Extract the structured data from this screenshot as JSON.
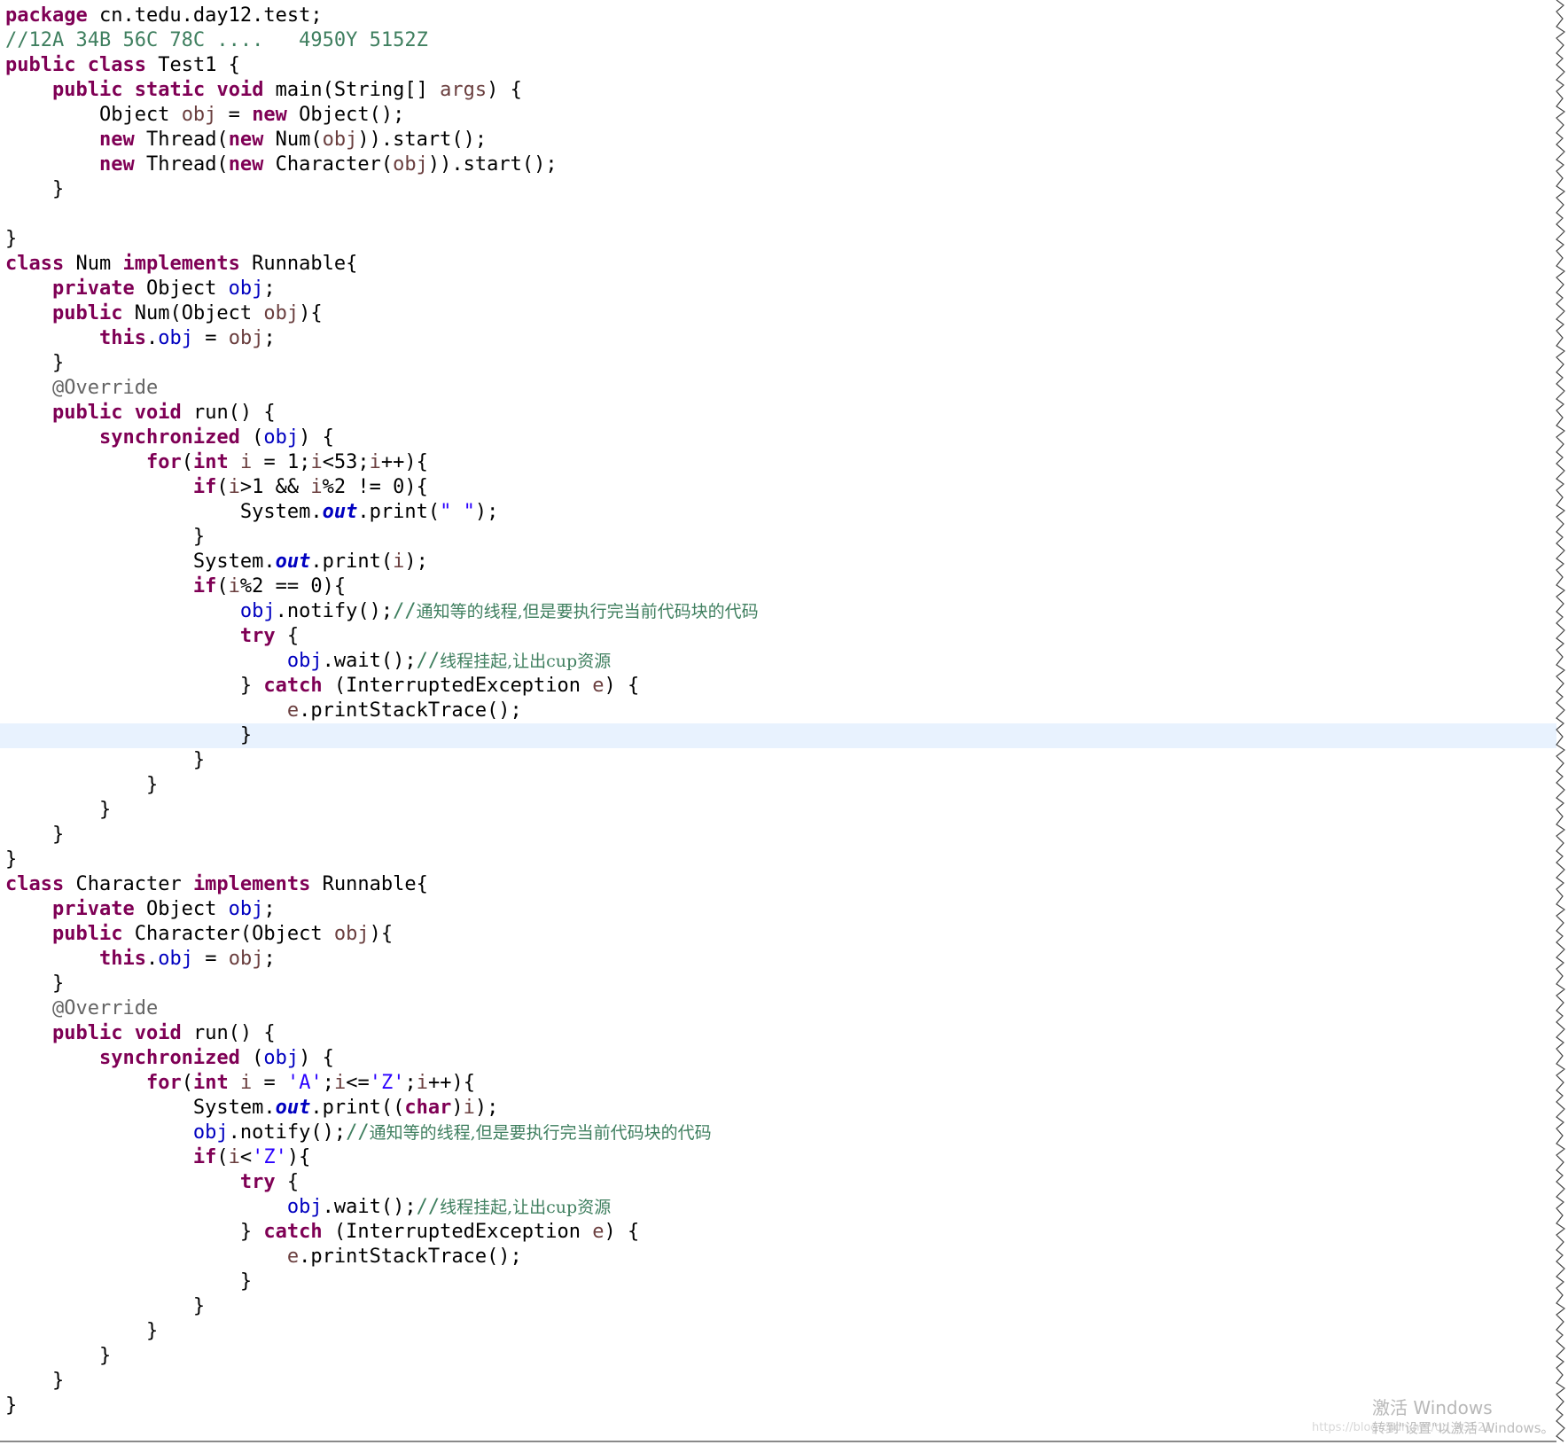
{
  "editor": {
    "language": "java",
    "current_line": 30,
    "colors": {
      "keyword": "#7f0055",
      "field": "#0000c0",
      "string": "#2a00ff",
      "comment": "#3f7f5f",
      "annotation": "#646464",
      "local_variable": "#6a3e3e",
      "current_line_highlight": "#e8f2fe"
    },
    "lines": [
      [
        {
          "t": "k",
          "v": "package"
        },
        {
          "t": "p",
          "v": " cn.tedu.day12.test;"
        }
      ],
      [
        {
          "t": "c",
          "v": "//12A 34B 56C 78C ....   4950Y 5152Z"
        }
      ],
      [
        {
          "t": "k",
          "v": "public"
        },
        {
          "t": "p",
          "v": " "
        },
        {
          "t": "k",
          "v": "class"
        },
        {
          "t": "p",
          "v": " Test1 {"
        }
      ],
      [
        {
          "t": "p",
          "v": "    "
        },
        {
          "t": "k",
          "v": "public"
        },
        {
          "t": "p",
          "v": " "
        },
        {
          "t": "k",
          "v": "static"
        },
        {
          "t": "p",
          "v": " "
        },
        {
          "t": "k",
          "v": "void"
        },
        {
          "t": "p",
          "v": " main(String[] "
        },
        {
          "t": "v",
          "v": "args"
        },
        {
          "t": "p",
          "v": ") {"
        }
      ],
      [
        {
          "t": "p",
          "v": "        Object "
        },
        {
          "t": "v",
          "v": "obj"
        },
        {
          "t": "p",
          "v": " = "
        },
        {
          "t": "k",
          "v": "new"
        },
        {
          "t": "p",
          "v": " Object();"
        }
      ],
      [
        {
          "t": "p",
          "v": "        "
        },
        {
          "t": "k",
          "v": "new"
        },
        {
          "t": "p",
          "v": " Thread("
        },
        {
          "t": "k",
          "v": "new"
        },
        {
          "t": "p",
          "v": " Num("
        },
        {
          "t": "v",
          "v": "obj"
        },
        {
          "t": "p",
          "v": ")).start();"
        }
      ],
      [
        {
          "t": "p",
          "v": "        "
        },
        {
          "t": "k",
          "v": "new"
        },
        {
          "t": "p",
          "v": " Thread("
        },
        {
          "t": "k",
          "v": "new"
        },
        {
          "t": "p",
          "v": " Character("
        },
        {
          "t": "v",
          "v": "obj"
        },
        {
          "t": "p",
          "v": ")).start();"
        }
      ],
      [
        {
          "t": "p",
          "v": "    }"
        }
      ],
      [
        {
          "t": "p",
          "v": ""
        }
      ],
      [
        {
          "t": "p",
          "v": "}"
        }
      ],
      [
        {
          "t": "k",
          "v": "class"
        },
        {
          "t": "p",
          "v": " Num "
        },
        {
          "t": "k",
          "v": "implements"
        },
        {
          "t": "p",
          "v": " Runnable{"
        }
      ],
      [
        {
          "t": "p",
          "v": "    "
        },
        {
          "t": "k",
          "v": "private"
        },
        {
          "t": "p",
          "v": " Object "
        },
        {
          "t": "f",
          "v": "obj"
        },
        {
          "t": "p",
          "v": ";"
        }
      ],
      [
        {
          "t": "p",
          "v": "    "
        },
        {
          "t": "k",
          "v": "public"
        },
        {
          "t": "p",
          "v": " Num(Object "
        },
        {
          "t": "v",
          "v": "obj"
        },
        {
          "t": "p",
          "v": "){"
        }
      ],
      [
        {
          "t": "p",
          "v": "        "
        },
        {
          "t": "k",
          "v": "this"
        },
        {
          "t": "p",
          "v": "."
        },
        {
          "t": "f",
          "v": "obj"
        },
        {
          "t": "p",
          "v": " = "
        },
        {
          "t": "v",
          "v": "obj"
        },
        {
          "t": "p",
          "v": ";"
        }
      ],
      [
        {
          "t": "p",
          "v": "    }"
        }
      ],
      [
        {
          "t": "p",
          "v": "    "
        },
        {
          "t": "a",
          "v": "@Override"
        }
      ],
      [
        {
          "t": "p",
          "v": "    "
        },
        {
          "t": "k",
          "v": "public"
        },
        {
          "t": "p",
          "v": " "
        },
        {
          "t": "k",
          "v": "void"
        },
        {
          "t": "p",
          "v": " run() {"
        }
      ],
      [
        {
          "t": "p",
          "v": "        "
        },
        {
          "t": "k",
          "v": "synchronized"
        },
        {
          "t": "p",
          "v": " ("
        },
        {
          "t": "f",
          "v": "obj"
        },
        {
          "t": "p",
          "v": ") {"
        }
      ],
      [
        {
          "t": "p",
          "v": "            "
        },
        {
          "t": "k",
          "v": "for"
        },
        {
          "t": "p",
          "v": "("
        },
        {
          "t": "k",
          "v": "int"
        },
        {
          "t": "p",
          "v": " "
        },
        {
          "t": "v",
          "v": "i"
        },
        {
          "t": "p",
          "v": " = 1;"
        },
        {
          "t": "v",
          "v": "i"
        },
        {
          "t": "p",
          "v": "<53;"
        },
        {
          "t": "v",
          "v": "i"
        },
        {
          "t": "p",
          "v": "++){"
        }
      ],
      [
        {
          "t": "p",
          "v": "                "
        },
        {
          "t": "k",
          "v": "if"
        },
        {
          "t": "p",
          "v": "("
        },
        {
          "t": "v",
          "v": "i"
        },
        {
          "t": "p",
          "v": ">1 && "
        },
        {
          "t": "v",
          "v": "i"
        },
        {
          "t": "p",
          "v": "%2 != 0){"
        }
      ],
      [
        {
          "t": "p",
          "v": "                    System."
        },
        {
          "t": "sf",
          "v": "out"
        },
        {
          "t": "p",
          "v": ".print("
        },
        {
          "t": "s",
          "v": "\" \""
        },
        {
          "t": "p",
          "v": ");"
        }
      ],
      [
        {
          "t": "p",
          "v": "                }"
        }
      ],
      [
        {
          "t": "p",
          "v": "                System."
        },
        {
          "t": "sf",
          "v": "out"
        },
        {
          "t": "p",
          "v": ".print("
        },
        {
          "t": "v",
          "v": "i"
        },
        {
          "t": "p",
          "v": ");"
        }
      ],
      [
        {
          "t": "p",
          "v": "                "
        },
        {
          "t": "k",
          "v": "if"
        },
        {
          "t": "p",
          "v": "("
        },
        {
          "t": "v",
          "v": "i"
        },
        {
          "t": "p",
          "v": "%2 == 0){"
        }
      ],
      [
        {
          "t": "p",
          "v": "                    "
        },
        {
          "t": "f",
          "v": "obj"
        },
        {
          "t": "p",
          "v": ".notify();"
        },
        {
          "t": "c",
          "v": "//"
        },
        {
          "t": "ca",
          "v": "通知等的线程,但是要执行完当前代码块的代码"
        }
      ],
      [
        {
          "t": "p",
          "v": "                    "
        },
        {
          "t": "k",
          "v": "try"
        },
        {
          "t": "p",
          "v": " {"
        }
      ],
      [
        {
          "t": "p",
          "v": "                        "
        },
        {
          "t": "f",
          "v": "obj"
        },
        {
          "t": "p",
          "v": ".wait();"
        },
        {
          "t": "c",
          "v": "//"
        },
        {
          "t": "ca",
          "v": "线程挂起,让出cup资源"
        }
      ],
      [
        {
          "t": "p",
          "v": "                    } "
        },
        {
          "t": "k",
          "v": "catch"
        },
        {
          "t": "p",
          "v": " (InterruptedException "
        },
        {
          "t": "v",
          "v": "e"
        },
        {
          "t": "p",
          "v": ") {"
        }
      ],
      [
        {
          "t": "p",
          "v": "                        "
        },
        {
          "t": "v",
          "v": "e"
        },
        {
          "t": "p",
          "v": ".printStackTrace();"
        }
      ],
      [
        {
          "t": "p",
          "v": "                    }"
        }
      ],
      [
        {
          "t": "p",
          "v": "                }"
        }
      ],
      [
        {
          "t": "p",
          "v": "            }"
        }
      ],
      [
        {
          "t": "p",
          "v": "        }"
        }
      ],
      [
        {
          "t": "p",
          "v": "    }"
        }
      ],
      [
        {
          "t": "p",
          "v": "}"
        }
      ],
      [
        {
          "t": "k",
          "v": "class"
        },
        {
          "t": "p",
          "v": " Character "
        },
        {
          "t": "k",
          "v": "implements"
        },
        {
          "t": "p",
          "v": " Runnable{"
        }
      ],
      [
        {
          "t": "p",
          "v": "    "
        },
        {
          "t": "k",
          "v": "private"
        },
        {
          "t": "p",
          "v": " Object "
        },
        {
          "t": "f",
          "v": "obj"
        },
        {
          "t": "p",
          "v": ";"
        }
      ],
      [
        {
          "t": "p",
          "v": "    "
        },
        {
          "t": "k",
          "v": "public"
        },
        {
          "t": "p",
          "v": " Character(Object "
        },
        {
          "t": "v",
          "v": "obj"
        },
        {
          "t": "p",
          "v": "){"
        }
      ],
      [
        {
          "t": "p",
          "v": "        "
        },
        {
          "t": "k",
          "v": "this"
        },
        {
          "t": "p",
          "v": "."
        },
        {
          "t": "f",
          "v": "obj"
        },
        {
          "t": "p",
          "v": " = "
        },
        {
          "t": "v",
          "v": "obj"
        },
        {
          "t": "p",
          "v": ";"
        }
      ],
      [
        {
          "t": "p",
          "v": "    }"
        }
      ],
      [
        {
          "t": "p",
          "v": "    "
        },
        {
          "t": "a",
          "v": "@Override"
        }
      ],
      [
        {
          "t": "p",
          "v": "    "
        },
        {
          "t": "k",
          "v": "public"
        },
        {
          "t": "p",
          "v": " "
        },
        {
          "t": "k",
          "v": "void"
        },
        {
          "t": "p",
          "v": " run() {"
        }
      ],
      [
        {
          "t": "p",
          "v": "        "
        },
        {
          "t": "k",
          "v": "synchronized"
        },
        {
          "t": "p",
          "v": " ("
        },
        {
          "t": "f",
          "v": "obj"
        },
        {
          "t": "p",
          "v": ") {"
        }
      ],
      [
        {
          "t": "p",
          "v": "            "
        },
        {
          "t": "k",
          "v": "for"
        },
        {
          "t": "p",
          "v": "("
        },
        {
          "t": "k",
          "v": "int"
        },
        {
          "t": "p",
          "v": " "
        },
        {
          "t": "v",
          "v": "i"
        },
        {
          "t": "p",
          "v": " = "
        },
        {
          "t": "s",
          "v": "'A'"
        },
        {
          "t": "p",
          "v": ";"
        },
        {
          "t": "v",
          "v": "i"
        },
        {
          "t": "p",
          "v": "<="
        },
        {
          "t": "s",
          "v": "'Z'"
        },
        {
          "t": "p",
          "v": ";"
        },
        {
          "t": "v",
          "v": "i"
        },
        {
          "t": "p",
          "v": "++){"
        }
      ],
      [
        {
          "t": "p",
          "v": "                System."
        },
        {
          "t": "sf",
          "v": "out"
        },
        {
          "t": "p",
          "v": ".print(("
        },
        {
          "t": "k",
          "v": "char"
        },
        {
          "t": "p",
          "v": ")"
        },
        {
          "t": "v",
          "v": "i"
        },
        {
          "t": "p",
          "v": ");"
        }
      ],
      [
        {
          "t": "p",
          "v": "                "
        },
        {
          "t": "f",
          "v": "obj"
        },
        {
          "t": "p",
          "v": ".notify();"
        },
        {
          "t": "c",
          "v": "//"
        },
        {
          "t": "ca",
          "v": "通知等的线程,但是要执行完当前代码块的代码"
        }
      ],
      [
        {
          "t": "p",
          "v": "                "
        },
        {
          "t": "k",
          "v": "if"
        },
        {
          "t": "p",
          "v": "("
        },
        {
          "t": "v",
          "v": "i"
        },
        {
          "t": "p",
          "v": "<"
        },
        {
          "t": "s",
          "v": "'Z'"
        },
        {
          "t": "p",
          "v": "){"
        }
      ],
      [
        {
          "t": "p",
          "v": "                    "
        },
        {
          "t": "k",
          "v": "try"
        },
        {
          "t": "p",
          "v": " {"
        }
      ],
      [
        {
          "t": "p",
          "v": "                        "
        },
        {
          "t": "f",
          "v": "obj"
        },
        {
          "t": "p",
          "v": ".wait();"
        },
        {
          "t": "c",
          "v": "//"
        },
        {
          "t": "ca",
          "v": "线程挂起,让出cup资源"
        }
      ],
      [
        {
          "t": "p",
          "v": "                    } "
        },
        {
          "t": "k",
          "v": "catch"
        },
        {
          "t": "p",
          "v": " (InterruptedException "
        },
        {
          "t": "v",
          "v": "e"
        },
        {
          "t": "p",
          "v": ") {"
        }
      ],
      [
        {
          "t": "p",
          "v": "                        "
        },
        {
          "t": "v",
          "v": "e"
        },
        {
          "t": "p",
          "v": ".printStackTrace();"
        }
      ],
      [
        {
          "t": "p",
          "v": "                    }"
        }
      ],
      [
        {
          "t": "p",
          "v": "                }"
        }
      ],
      [
        {
          "t": "p",
          "v": "            }"
        }
      ],
      [
        {
          "t": "p",
          "v": "        }"
        }
      ],
      [
        {
          "t": "p",
          "v": "    }"
        }
      ],
      [
        {
          "t": "p",
          "v": "}"
        }
      ]
    ]
  },
  "watermark": {
    "title": "激活 Windows",
    "subtitle": "转到\"设置\"以激活 Windows。",
    "url_text": "https://blog.csdn.net/qq_43521"
  }
}
